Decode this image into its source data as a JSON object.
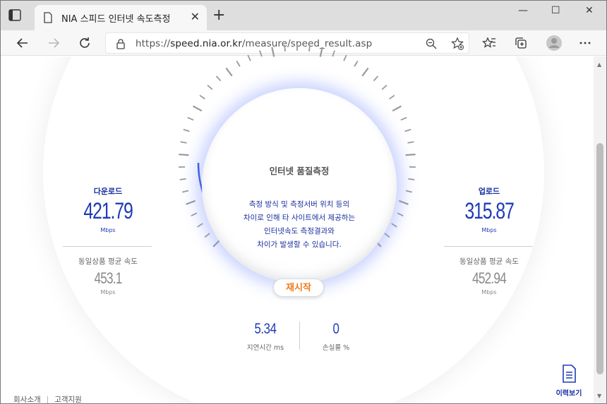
{
  "browser": {
    "tab_title": "NIA 스피드 인터넷 속도측정",
    "url_scheme": "https://",
    "url_host": "speed.nia.or.kr",
    "url_path": "/measure/speed_result.asp",
    "new_tab_label": "+",
    "tab_close_label": "✕",
    "window_controls": {
      "minimize": "—",
      "maximize": "☐",
      "close": "✕"
    },
    "icons": [
      "tab-actions-icon",
      "page-icon",
      "back-arrow-icon",
      "forward-arrow-icon",
      "refresh-icon",
      "lock-icon",
      "zoom-out-icon",
      "add-favorite-icon",
      "favorites-icon",
      "collections-icon",
      "profile-icon",
      "more-icon"
    ]
  },
  "measurement": {
    "title": "인터넷 품질측정",
    "description": [
      "측정 방식 및 측정서버 위치 등의",
      "차이로 인해 타 사이트에서 제공하는",
      "인터넷속도 측정결과와",
      "차이가 발생할 수 있습니다."
    ],
    "restart_label": "재시작"
  },
  "download": {
    "label": "다운로드",
    "value": "421.79",
    "unit": "Mbps",
    "avg_label": "동일상품 평균 속도",
    "avg_value": "453.1",
    "avg_unit": "Mbps"
  },
  "upload": {
    "label": "업로드",
    "value": "315.87",
    "unit": "Mbps",
    "avg_label": "동일상품 평균 속도",
    "avg_value": "452.94",
    "avg_unit": "Mbps"
  },
  "latency": {
    "value": "5.34",
    "label": "지연시간 ms"
  },
  "loss": {
    "value": "0",
    "label": "손실률 %"
  },
  "history": {
    "label": "이력보기"
  },
  "footer": {
    "links": [
      "회사소개",
      "고객지원"
    ]
  },
  "colors": {
    "accent": "#1f3bb8",
    "restart": "#f07a1a",
    "glow": "#8296ff"
  }
}
